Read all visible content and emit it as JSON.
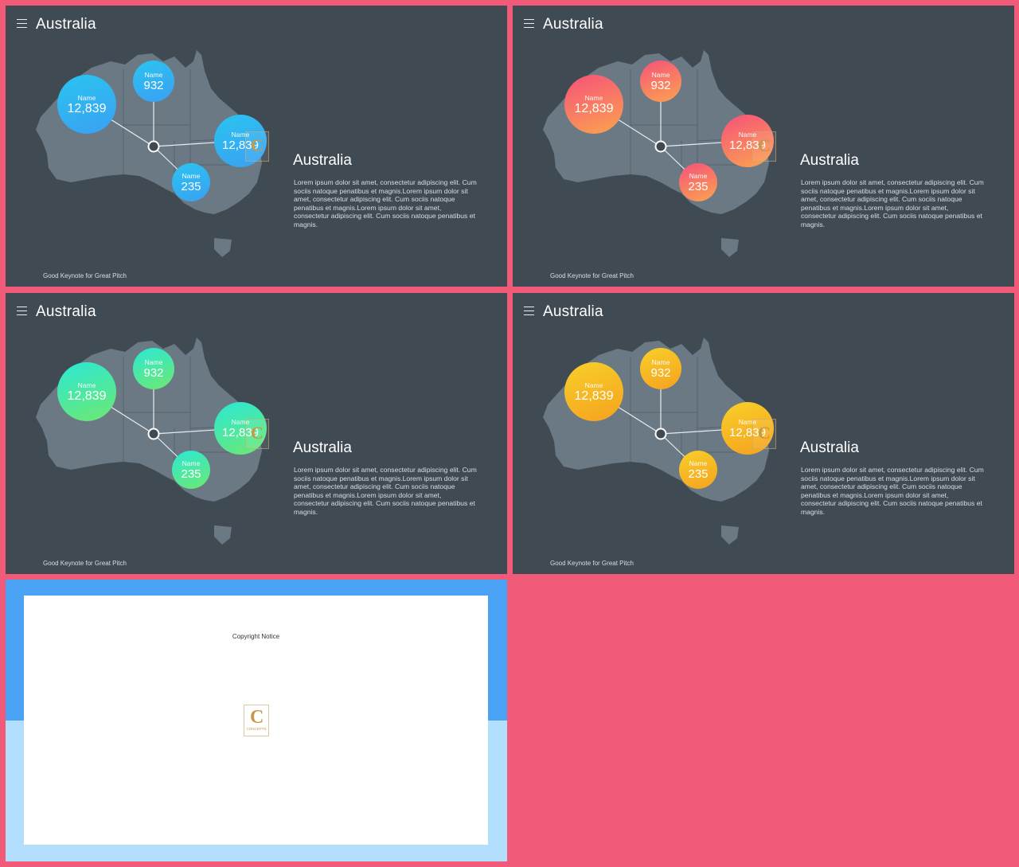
{
  "slides": [
    {
      "title": "Australia",
      "desc_title": "Australia",
      "desc_body": "Lorem ipsum dolor sit amet, consectetur adipiscing elit. Cum sociis natoque penatibus et magnis.Lorem ipsum dolor sit amet, consectetur adipiscing elit. Cum sociis natoque penatibus et magnis.Lorem ipsum dolor sit amet, consectetur adipiscing elit. Cum sociis natoque penatibus et magnis.",
      "footer": "Good Keynote for Great Pitch",
      "gradient": [
        "#2bc4f0",
        "#3aa0f2"
      ],
      "bubbles": [
        {
          "label": "Name",
          "value": "12,839"
        },
        {
          "label": "Name",
          "value": "932"
        },
        {
          "label": "Name",
          "value": "12,839"
        },
        {
          "label": "Name",
          "value": "235"
        }
      ]
    },
    {
      "title": "Australia",
      "desc_title": "Australia",
      "desc_body": "Lorem ipsum dolor sit amet, consectetur adipiscing elit. Cum sociis natoque penatibus et magnis.Lorem ipsum dolor sit amet, consectetur adipiscing elit. Cum sociis natoque penatibus et magnis.Lorem ipsum dolor sit amet, consectetur adipiscing elit. Cum sociis natoque penatibus et magnis.",
      "footer": "Good Keynote for Great Pitch",
      "gradient": [
        "#f6527a",
        "#fba34f"
      ],
      "bubbles": [
        {
          "label": "Name",
          "value": "12,839"
        },
        {
          "label": "Name",
          "value": "932"
        },
        {
          "label": "Name",
          "value": "12,839"
        },
        {
          "label": "Name",
          "value": "235"
        }
      ]
    },
    {
      "title": "Australia",
      "desc_title": "Australia",
      "desc_body": "Lorem ipsum dolor sit amet, consectetur adipiscing elit. Cum sociis natoque penatibus et magnis.Lorem ipsum dolor sit amet, consectetur adipiscing elit. Cum sociis natoque penatibus et magnis.Lorem ipsum dolor sit amet, consectetur adipiscing elit. Cum sociis natoque penatibus et magnis.",
      "footer": "Good Keynote for Great Pitch",
      "gradient": [
        "#2ae8d6",
        "#6ee870"
      ],
      "bubbles": [
        {
          "label": "Name",
          "value": "12,839"
        },
        {
          "label": "Name",
          "value": "932"
        },
        {
          "label": "Name",
          "value": "12,839"
        },
        {
          "label": "Name",
          "value": "235"
        }
      ]
    },
    {
      "title": "Australia",
      "desc_title": "Australia",
      "desc_body": "Lorem ipsum dolor sit amet, consectetur adipiscing elit. Cum sociis natoque penatibus et magnis.Lorem ipsum dolor sit amet, consectetur adipiscing elit. Cum sociis natoque penatibus et magnis.Lorem ipsum dolor sit amet, consectetur adipiscing elit. Cum sociis natoque penatibus et magnis.",
      "footer": "Good Keynote for Great Pitch",
      "gradient": [
        "#f8cf2a",
        "#f5a21e"
      ],
      "bubbles": [
        {
          "label": "Name",
          "value": "12,839"
        },
        {
          "label": "Name",
          "value": "932"
        },
        {
          "label": "Name",
          "value": "12,839"
        },
        {
          "label": "Name",
          "value": "235"
        }
      ]
    }
  ],
  "copyright": {
    "notice": "Copyright Notice",
    "logo_letter": "C",
    "logo_text": "CONCEPTS"
  },
  "colors": {
    "background": "#f15b79",
    "slide": "#404a53",
    "map": "#6b7985"
  }
}
